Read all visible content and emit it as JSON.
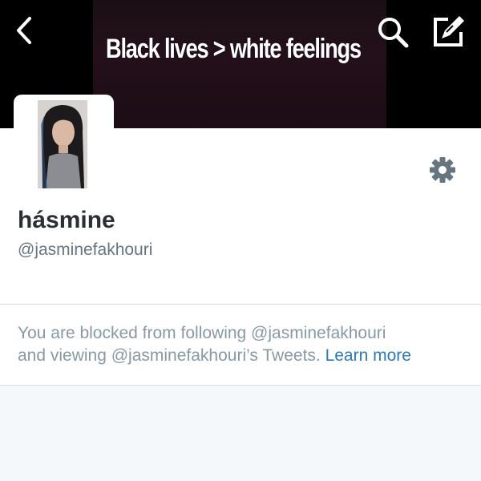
{
  "header": {
    "banner_text": "Black lives > white feelings",
    "back_icon": "chevron-left-icon",
    "search_icon": "search-icon",
    "compose_icon": "compose-icon"
  },
  "profile": {
    "display_name": "hásmine",
    "handle": "@jasminefakhouri",
    "settings_icon": "gear-icon"
  },
  "blocked_notice": {
    "line1": "You are blocked from following @jasminefakhouri",
    "line2": "and viewing @jasminefakhouri’s Tweets.",
    "link_label": "Learn more"
  },
  "colors": {
    "link": "#2b7bb9",
    "muted_text": "#8899a6",
    "name_text": "#292f33",
    "handle_text": "#66757f",
    "background": "#f5f8fa"
  }
}
